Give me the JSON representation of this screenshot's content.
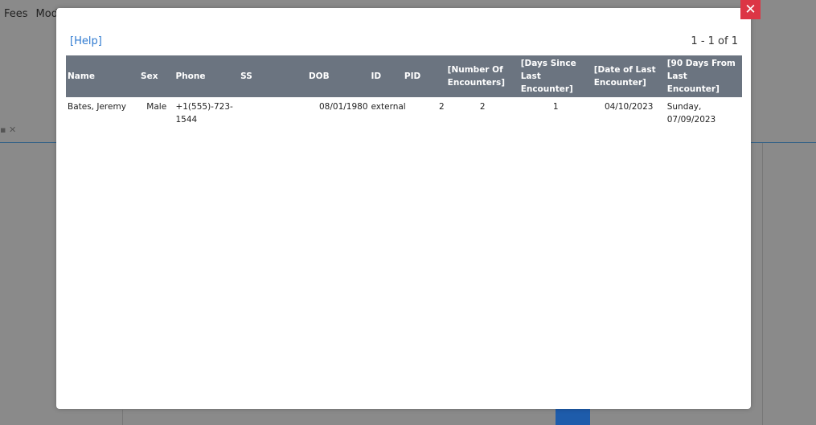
{
  "background": {
    "menu_items": [
      "Fees",
      "Mod"
    ]
  },
  "modal": {
    "help_label": "[Help]",
    "pager_text": "1 - 1 of 1",
    "close_icon": "✕",
    "columns": [
      "Name",
      "Sex",
      "Phone",
      "SS",
      "DOB",
      "ID",
      "PID",
      "[Number Of Encounters]",
      "[Days Since Last Encounter]",
      "[Date of Last Encounter]",
      "[90 Days From Last Encounter]"
    ],
    "rows": [
      {
        "name": "Bates, Jeremy",
        "sex": "Male",
        "phone": "+1(555)-723-1544",
        "ss": "",
        "dob": "08/01/1980",
        "id": "external",
        "pid": "2",
        "num_encounters": "2",
        "days_since_last": "1",
        "date_last": "04/10/2023",
        "ninety_days": "Sunday, 07/09/2023"
      }
    ]
  }
}
